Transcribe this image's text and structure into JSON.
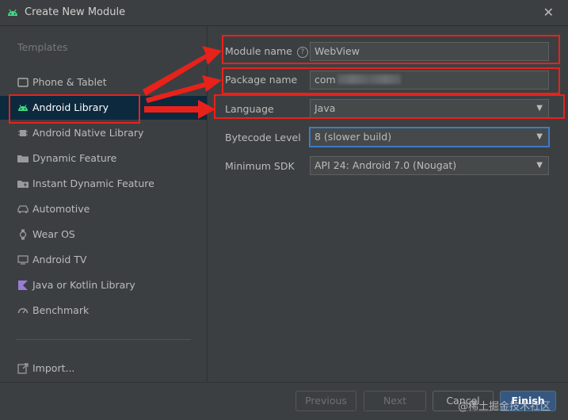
{
  "window": {
    "title": "Create New Module"
  },
  "sidebar": {
    "heading": "Templates",
    "items": [
      {
        "label": "Phone & Tablet",
        "icon": "phone-tablet-icon"
      },
      {
        "label": "Android Library",
        "icon": "android-icon",
        "selected": true
      },
      {
        "label": "Android Native Library",
        "icon": "chip-icon"
      },
      {
        "label": "Dynamic Feature",
        "icon": "folder-icon"
      },
      {
        "label": "Instant Dynamic Feature",
        "icon": "folder-icon"
      },
      {
        "label": "Automotive",
        "icon": "car-icon"
      },
      {
        "label": "Wear OS",
        "icon": "watch-icon"
      },
      {
        "label": "Android TV",
        "icon": "tv-icon"
      },
      {
        "label": "Java or Kotlin Library",
        "icon": "kotlin-icon"
      },
      {
        "label": "Benchmark",
        "icon": "gauge-icon"
      }
    ],
    "import_label": "Import..."
  },
  "form": {
    "module_name": {
      "label": "Module name",
      "value": "WebView"
    },
    "package_name": {
      "label": "Package name",
      "value": "com"
    },
    "language": {
      "label": "Language",
      "value": "Java"
    },
    "bytecode_level": {
      "label": "Bytecode Level",
      "value": "8 (slower build)"
    },
    "minimum_sdk": {
      "label": "Minimum SDK",
      "value": "API 24: Android 7.0 (Nougat)"
    }
  },
  "footer": {
    "previous": "Previous",
    "next": "Next",
    "cancel": "Cancel",
    "finish": "Finish"
  },
  "watermark": "@稀土掘金技术社区",
  "colors": {
    "background": "#3c3f41",
    "selection": "#0d293e",
    "focus": "#3d7bc4",
    "primary_button": "#365880",
    "annotation": "#e8221b",
    "android_green": "#3ddc84"
  }
}
